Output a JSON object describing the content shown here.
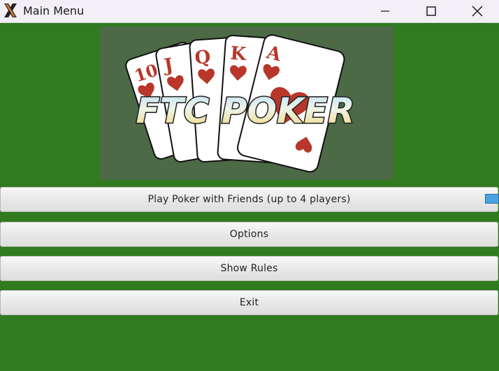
{
  "window": {
    "title": "Main Menu",
    "icon": "x-app-icon",
    "controls": {
      "minimize_icon": "minimize-icon",
      "maximize_icon": "maximize-icon",
      "close_icon": "close-icon"
    }
  },
  "logo": {
    "text": "FTC POKER",
    "cards": [
      {
        "rank": "10",
        "suit": "hearts"
      },
      {
        "rank": "J",
        "suit": "hearts"
      },
      {
        "rank": "Q",
        "suit": "hearts"
      },
      {
        "rank": "K",
        "suit": "hearts"
      },
      {
        "rank": "A",
        "suit": "hearts"
      }
    ]
  },
  "menu": {
    "play_label": "Play Poker with Friends (up to 4 players)",
    "options_label": "Options",
    "rules_label": "Show Rules",
    "exit_label": "Exit"
  },
  "colors": {
    "background_green": "#307a1f",
    "logo_panel": "#4b6a45",
    "heart_red": "#b8372a",
    "focus_blue": "#4aa3df"
  }
}
